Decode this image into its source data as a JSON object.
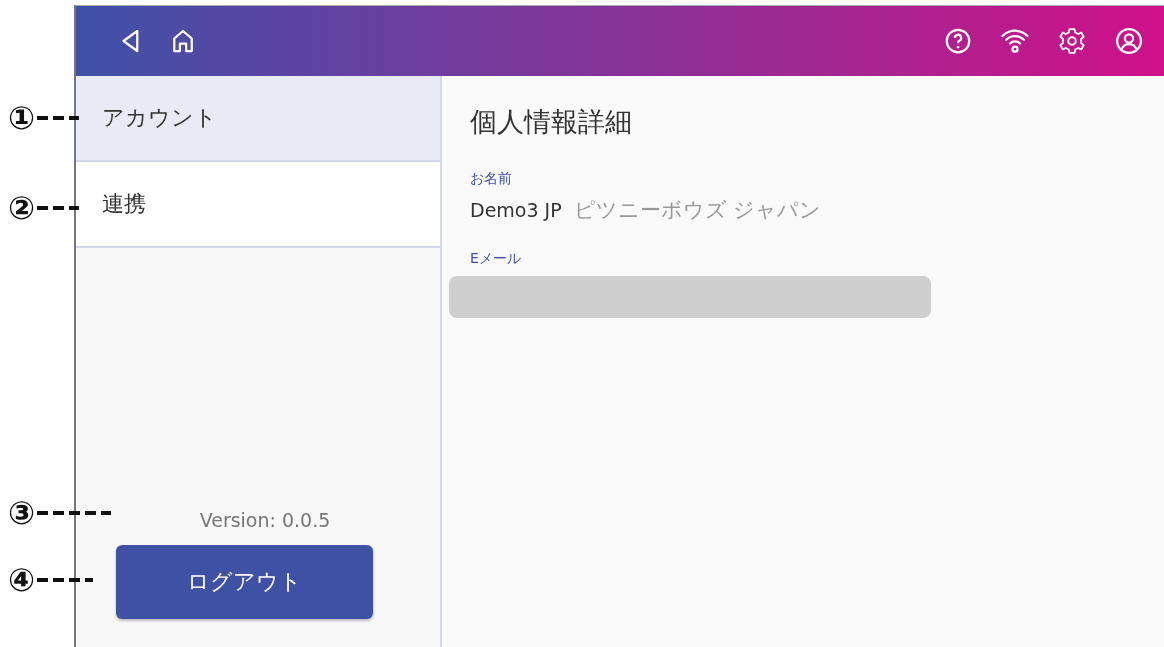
{
  "top_bar": {
    "left_icons": [
      {
        "kind": "back"
      },
      {
        "kind": "home"
      }
    ],
    "right_icons": [
      {
        "kind": "help"
      },
      {
        "kind": "wifi"
      },
      {
        "kind": "settings"
      },
      {
        "kind": "account"
      }
    ]
  },
  "sidebar": {
    "items": [
      {
        "label": "アカウント",
        "selected": true
      },
      {
        "label": "連携",
        "selected": false
      }
    ],
    "version": "Version: 0.0.5",
    "logout_button": "ログアウト"
  },
  "content": {
    "title": "個人情報詳細",
    "fields": [
      {
        "kind": "text",
        "label": "お名前",
        "value": "Demo3 JP",
        "value_2": "ピツニーボウズ ジャパン"
      },
      {
        "kind": "redacted",
        "label": "Eメール"
      }
    ]
  },
  "annotations": [
    {
      "label": "①"
    },
    {
      "label": "②"
    },
    {
      "label": "③"
    },
    {
      "label": "④"
    }
  ]
}
